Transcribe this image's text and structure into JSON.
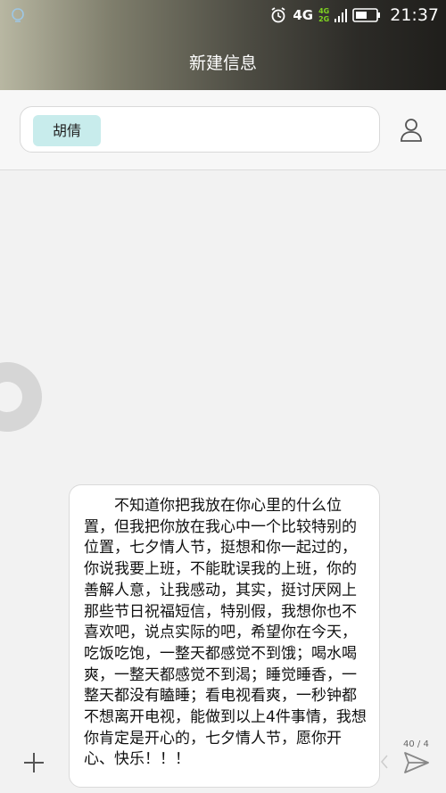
{
  "status_bar": {
    "network_label": "4G",
    "network_top": "4G",
    "network_bottom": "2G",
    "clock": "21:37"
  },
  "header": {
    "title": "新建信息"
  },
  "recipient": {
    "name": "胡倩"
  },
  "message": {
    "text": "不知道你把我放在你心里的什么位置，但我把你放在我心中一个比较特别的位置，七夕情人节，挺想和你一起过的，你说我要上班，不能耽误我的上班，你的善解人意，让我感动，其实，挺讨厌网上那些节日祝福短信，特别假，我想你也不喜欢吧，说点实际的吧，希望你在今天，吃饭吃饱，一整天都感觉不到饿；喝水喝爽，一整天都感觉不到渴；睡觉睡香，一整天都没有瞌睡；看电视看爽，一秒钟都不想离开电视，能做到以上4件事情，我想你肯定是开心的，七夕情人节，愿你开心、快乐！！！",
    "counter": "40 / 4"
  },
  "icons": {
    "status_left": "notification-icon",
    "alarm": "alarm-icon",
    "signal": "signal-icon",
    "battery": "battery-icon",
    "contact": "contact-icon",
    "add": "plus-icon",
    "send": "send-icon",
    "chevron": "chevron-left-icon",
    "loader": "loading-ring-icon"
  },
  "colors": {
    "chip_bg": "#c8ecec",
    "header_dark": "#1f1e1b",
    "background": "#f2f2f2"
  }
}
